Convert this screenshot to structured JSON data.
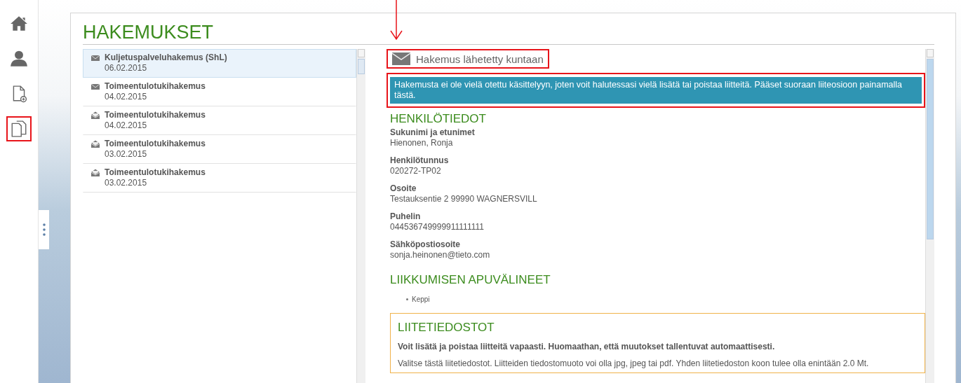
{
  "sidebar": {
    "items": [
      {
        "kind": "home",
        "selected": false
      },
      {
        "kind": "user",
        "selected": false
      },
      {
        "kind": "new-document",
        "selected": false
      },
      {
        "kind": "documents",
        "selected": true
      }
    ]
  },
  "page": {
    "title": "HAKEMUKSET"
  },
  "applications": [
    {
      "title": "Kuljetuspalveluhakemus (ShL)",
      "date": "06.02.2015",
      "kind": "closed",
      "selected": true
    },
    {
      "title": "Toimeentulotukihakemus",
      "date": "04.02.2015",
      "kind": "closed",
      "selected": false
    },
    {
      "title": "Toimeentulotukihakemus",
      "date": "04.02.2015",
      "kind": "open",
      "selected": false
    },
    {
      "title": "Toimeentulotukihakemus",
      "date": "03.02.2015",
      "kind": "open",
      "selected": false
    },
    {
      "title": "Toimeentulotukihakemus",
      "date": "03.02.2015",
      "kind": "open",
      "selected": false
    }
  ],
  "detail": {
    "status": {
      "text": "Hakemus lähetetty kuntaan",
      "highlighted": true
    },
    "notice": {
      "text": "Hakemusta ei ole vielä otettu käsittelyyn, joten voit halutessasi vielä lisätä tai poistaa liitteitä. Pääset suoraan liiteosioon painamalla tästä.",
      "highlighted": true
    },
    "personal": {
      "heading": "HENKILÖTIEDOT",
      "fields": [
        {
          "label": "Sukunimi ja etunimet",
          "value": "Hienonen, Ronja"
        },
        {
          "label": "Henkilötunnus",
          "value": "020272-TP02"
        },
        {
          "label": "Osoite",
          "value": "Testauksentie 2 99990 WAGNERSVILL"
        },
        {
          "label": "Puhelin",
          "value": "044536749999911111111"
        },
        {
          "label": "Sähköpostiosoite",
          "value": "sonja.heinonen@tieto.com"
        }
      ]
    },
    "aids": {
      "heading": "LIIKKUMISEN APUVÄLINEET",
      "items": [
        "Keppi"
      ]
    },
    "attachments": {
      "heading": "LIITETIEDOSTOT",
      "intro": "Voit lisätä ja poistaa liitteitä vapaasti. Huomaathan, että muutokset tallentuvat automaattisesti.",
      "help": "Valitse tästä liitetiedostot. Liitteiden tiedostomuoto voi olla jpg, jpeg tai pdf. Yhden liitetiedoston koon tulee olla enintään 2.0 Mt."
    }
  }
}
